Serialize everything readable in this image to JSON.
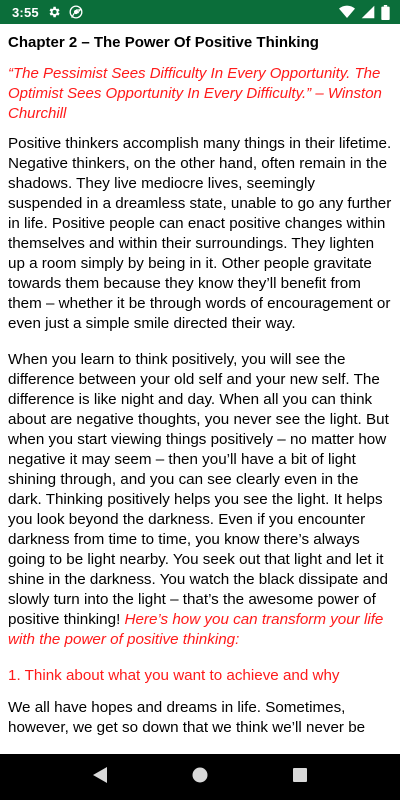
{
  "status_bar": {
    "time": "3:55",
    "bg_color": "#0b6e3a",
    "icons": [
      "gear-icon",
      "chrome-icon",
      "wifi-icon",
      "signal-icon",
      "battery-icon"
    ]
  },
  "article": {
    "chapter_title": "Chapter 2 – The Power Of Positive Thinking",
    "quote": "“The Pessimist Sees Difficulty In Every Opportunity. The Optimist Sees Opportunity In Every Difficulty.”  – Winston Churchill",
    "para1": " Positive thinkers accomplish many things in their lifetime. Negative thinkers, on the other hand, often remain in the shadows. They live mediocre lives, seemingly suspended in a dreamless state, unable to go any further in life.  Positive people can enact positive changes within themselves and within their surroundings. They lighten up a room simply by being in it. Other people gravitate towards them because they know they’ll benefit from them – whether it be through words of encouragement or even just a simple smile directed their way.",
    "para2": "When you learn to think positively, you will see the difference between your old self and your new self. The difference is like night and day. When all you can think about are negative thoughts, you never see the light. But when you start viewing things positively – no matter how negative it may seem – then you’ll have a bit of light shining through, and you can see clearly even in the dark. Thinking positively helps you see the light. It helps you look beyond the darkness. Even if you encounter darkness from time to time, you know there’s always going to be light nearby. You seek out that light and let it shine in the darkness. You watch the black dissipate and slowly turn into the light – that’s the awesome power of positive thinking!  ",
    "para2_red": "Here’s how you can transform your life with the power of positive thinking:",
    "heading1": "1. Think about what you want to achieve and why",
    "para3": "We all have hopes and dreams in life. Sometimes, however, we get so down that we think we’ll never be"
  },
  "accent_color": "#ff1a1a",
  "nav_bar": {
    "icons": [
      "back-icon",
      "home-icon",
      "recents-icon"
    ]
  }
}
